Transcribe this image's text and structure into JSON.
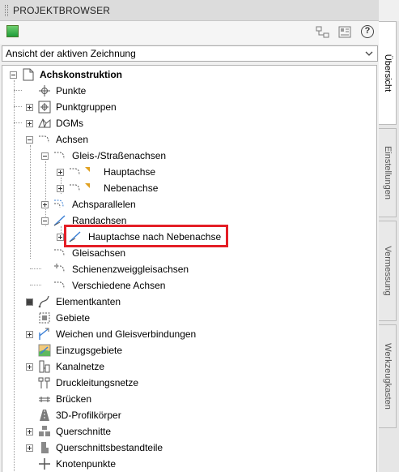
{
  "panel": {
    "title": "PROJEKTBROWSER",
    "view_select": "Ansicht der aktiven Zeichnung",
    "help_label": "?"
  },
  "tree": {
    "root": "Achskonstruktion",
    "items": [
      "Punkte",
      "Punktgruppen",
      "DGMs",
      "Achsen",
      "Gleis-/Straßenachsen",
      "Hauptachse",
      "Nebenachse",
      "Achsparallelen",
      "Randachsen",
      "Hauptachse nach Nebenachse",
      "Gleisachsen",
      "Schienenzweiggleisachsen",
      "Verschiedene Achsen",
      "Elementkanten",
      "Gebiete",
      "Weichen und Gleisverbindungen",
      "Einzugsgebiete",
      "Kanalnetze",
      "Druckleitungsnetze",
      "Brücken",
      "3D-Profilkörper",
      "Querschnitte",
      "Querschnittsbestandteile",
      "Knotenpunkte"
    ]
  },
  "side_tabs": [
    "Übersicht",
    "Einstellungen",
    "Vermessung",
    "Werkzeugkasten"
  ],
  "colors": {
    "highlight": "#e41e26",
    "flag": "#e0a020"
  }
}
